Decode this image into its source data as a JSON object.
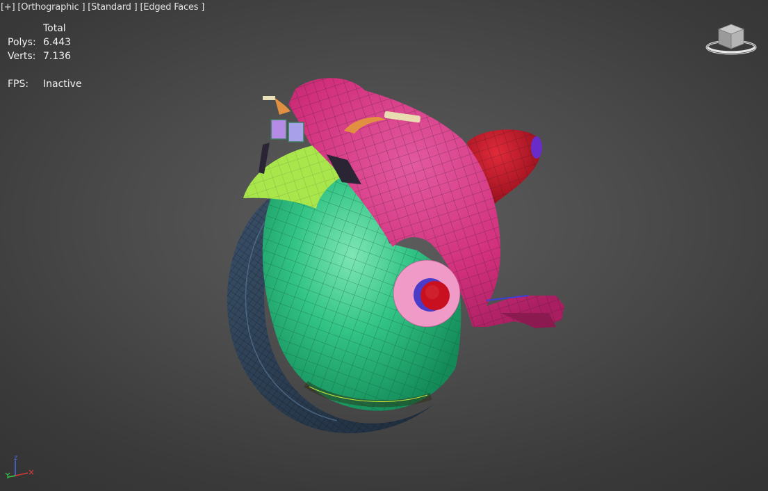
{
  "viewport": {
    "label_plus": "[+]",
    "label_view": "[Orthographic ]",
    "label_shading": "[Standard ]",
    "label_edges": "[Edged Faces ]"
  },
  "stats": {
    "header": "Total",
    "polys_label": "Polys:",
    "polys_value": "6.443",
    "verts_label": "Verts:",
    "verts_value": "7.136",
    "fps_label": "FPS:",
    "fps_value": "Inactive"
  },
  "axis_tripod": {
    "z_label": "z"
  },
  "colors": {
    "background": "#4b4b4b",
    "body_magenta": "#d6327f",
    "wheel_green": "#2fbf7f",
    "tire_dark": "#2a3d52",
    "fender_lime": "#9ee24a",
    "seat_red": "#b01020",
    "hub_pink": "#f09ac8",
    "hub_red": "#c81020",
    "hub_blue": "#4a3cc8"
  }
}
